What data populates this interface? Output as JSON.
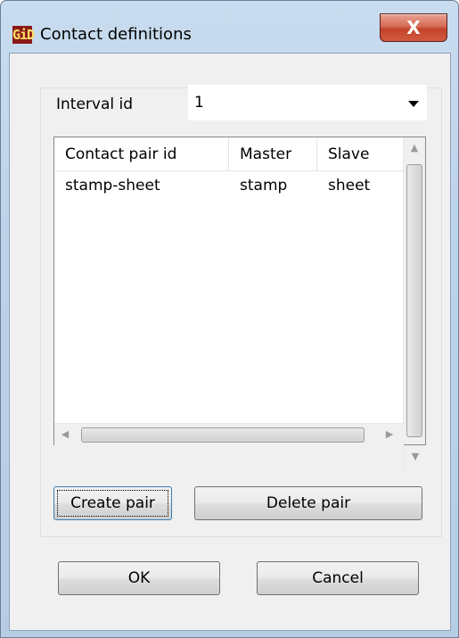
{
  "window": {
    "title": "Contact definitions",
    "logo_text": "GiD",
    "close_label": "X"
  },
  "interval": {
    "label": "Interval id",
    "selected": "1"
  },
  "table": {
    "columns": [
      "Contact pair id",
      "Master",
      "Slave"
    ],
    "rows": [
      [
        "stamp-sheet",
        "stamp",
        "sheet"
      ]
    ]
  },
  "buttons": {
    "create_pair": "Create pair",
    "delete_pair": "Delete pair",
    "ok": "OK",
    "cancel": "Cancel"
  },
  "icons": {
    "scroll_up": "scroll-up-icon",
    "scroll_down": "scroll-down-icon",
    "scroll_left": "scroll-left-icon",
    "scroll_right": "scroll-right-icon"
  }
}
